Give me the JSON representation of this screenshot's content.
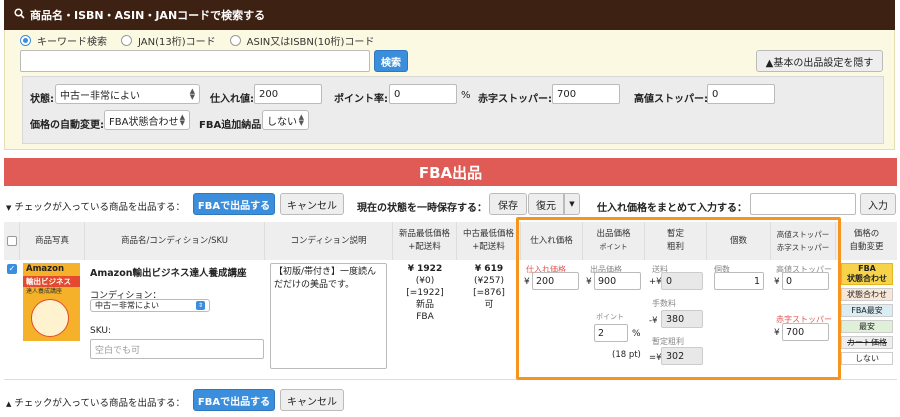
{
  "search": {
    "header": "商品名・ISBN・ASIN・JANコードで検索する",
    "radios": [
      "キーワード検索",
      "JAN(13桁)コード",
      "ASIN又はISBN(10桁)コード"
    ],
    "keyword_value": "",
    "search_button": "検索",
    "hide_settings_button": "▲基本の出品設定を隠す"
  },
  "settings": {
    "condition_label": "状態:",
    "condition_value": "中古ー非常によい",
    "purchase_label": "仕入れ値:",
    "purchase_value": "200",
    "point_label": "ポイント率:",
    "point_value": "0",
    "point_unit": "%",
    "red_stopper_label": "赤字ストッパー:",
    "red_stopper_value": "700",
    "high_stopper_label": "高値ストッパー:",
    "high_stopper_value": "0",
    "auto_price_label": "価格の自動変更:",
    "auto_price_value": "FBA状態合わせ",
    "fba_add_label": "FBA追加納品:",
    "fba_add_value": "しない"
  },
  "fba": {
    "title": "FBA出品",
    "list_checked_label": "チェックが入っている商品を出品する：",
    "list_fba_button": "FBAで出品する",
    "cancel_button": "キャンセル",
    "temp_save_label": "現在の状態を一時保存する：",
    "save_button": "保存",
    "restore_button": "復元",
    "bulk_purchase_label": "仕入れ価格をまとめて入力する：",
    "bulk_purchase_value": "",
    "enter_button": "入力"
  },
  "table": {
    "headers": {
      "photo": "商品写真",
      "name": "商品名/コンディション/SKU",
      "condition_desc": "コンディション説明",
      "new_min_1": "新品最低価格",
      "new_min_2": "+配送料",
      "used_min_1": "中古最低価格",
      "used_min_2": "+配送料",
      "purchase": "仕入れ価格",
      "list_price_1": "出品価格",
      "list_price_2": "ポイント",
      "profit_1": "暫定",
      "profit_2": "粗利",
      "qty": "個数",
      "stopper_1": "高値ストッパー",
      "stopper_2": "赤字ストッパー",
      "auto_1": "価格の",
      "auto_2": "自動変更"
    },
    "row": {
      "book_cover_text_1": "Amazon",
      "book_cover_text_2": "輸出ビジネス",
      "book_cover_text_3": "達人養成講座",
      "title": "Amazon輸出ビジネス達人養成講座",
      "condition_label": "コンディション：",
      "condition_value": "中古ー非常によい",
      "sku_label": "SKU:",
      "sku_placeholder": "空白でも可",
      "condition_desc": "【初版/帯付き】一度読んだだけの美品です。",
      "new_price": "¥ 1922",
      "new_ship": "(¥0)",
      "new_total": "[=1922]",
      "new_cond": "新品",
      "new_channel": "FBA",
      "used_price": "¥ 619",
      "used_ship": "(¥257)",
      "used_total": "[=876]",
      "used_cond": "可",
      "purchase_label": "仕入れ価格",
      "purchase_currency": "¥",
      "purchase_value": "200",
      "list_label": "出品価格",
      "list_currency": "¥",
      "list_value": "900",
      "point_label": "ポイント",
      "point_value": "2",
      "point_unit": "%",
      "point_pt": "(18 pt)",
      "shipping_label": "送料",
      "shipping_prefix": "+¥",
      "shipping_value": "0",
      "fee_label": "手数料",
      "fee_prefix": "-¥",
      "fee_value": "380",
      "profit_label": "暫定粗利",
      "profit_prefix": "=¥",
      "profit_value": "302",
      "qty_label": "個数",
      "qty_value": "1",
      "high_label": "高値ストッパー",
      "high_currency": "¥",
      "high_value": "0",
      "red_label": "赤字ストッパー",
      "red_currency": "¥",
      "red_value": "700",
      "auto_options": [
        "FBA\n状態合わせ",
        "状態合わせ",
        "FBA最安",
        "最安",
        "カート価格",
        "しない"
      ]
    }
  },
  "footer": {
    "list_checked_label": "チェックが入っている商品を出品する：",
    "list_fba_button": "FBAで出品する",
    "cancel_button": "キャンセル"
  },
  "colors": {
    "header_brown": "#3d2214",
    "fba_red": "#e05b55",
    "accent_blue": "#3b8edb",
    "highlight_orange": "#f7941d",
    "auto_active": "#f6d34a"
  }
}
